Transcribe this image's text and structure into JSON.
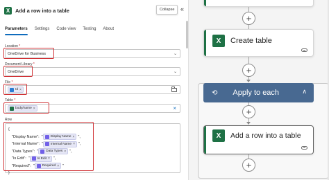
{
  "panel": {
    "title": "Add a row into a table",
    "collapse_tooltip": "Collapse",
    "collapse_icon": "«"
  },
  "tabs": [
    {
      "label": "Parameters",
      "active": true
    },
    {
      "label": "Settings",
      "active": false
    },
    {
      "label": "Code view",
      "active": false
    },
    {
      "label": "Testing",
      "active": false
    },
    {
      "label": "About",
      "active": false
    }
  ],
  "fields": {
    "location": {
      "label": "Location",
      "value": "OneDrive for Business"
    },
    "library": {
      "label": "Document Library",
      "value": "OneDrive"
    },
    "file": {
      "label": "File",
      "token": "Id"
    },
    "table": {
      "label": "Table",
      "token": "body/name"
    },
    "row": {
      "label": "Row"
    },
    "required_marker": "*"
  },
  "row_json": {
    "open": "{",
    "close": "}",
    "lines": [
      {
        "key": "\"Display Name\":",
        "pre": "\"",
        "token": "Display Name",
        "post": "\","
      },
      {
        "key": "\"Internal Name\":",
        "pre": "\"",
        "token": "Internal Name",
        "post": "\","
      },
      {
        "key": "\"Data Types\":",
        "pre": "\"",
        "token": "Data Types",
        "post": "\","
      },
      {
        "key": "\"Is Edit\":",
        "pre": "\"",
        "token": "Is Edit",
        "post": "\","
      },
      {
        "key": "\"Required\":",
        "pre": "\"",
        "token": "Required",
        "post": "\""
      }
    ]
  },
  "canvas": {
    "create_table_label": "Create table",
    "apply_each_label": "Apply to each",
    "add_row_label": "Add a row into a table",
    "plus_symbol": "+",
    "loop_icon": "⟲",
    "loop_collapse_icon": "∧",
    "excel_letter": "X"
  },
  "colors": {
    "accent": "#0f6cbd",
    "excel": "#1e7145",
    "loop_header": "#486991",
    "highlight": "#d13438",
    "token_bg": "#e6e7f6"
  }
}
